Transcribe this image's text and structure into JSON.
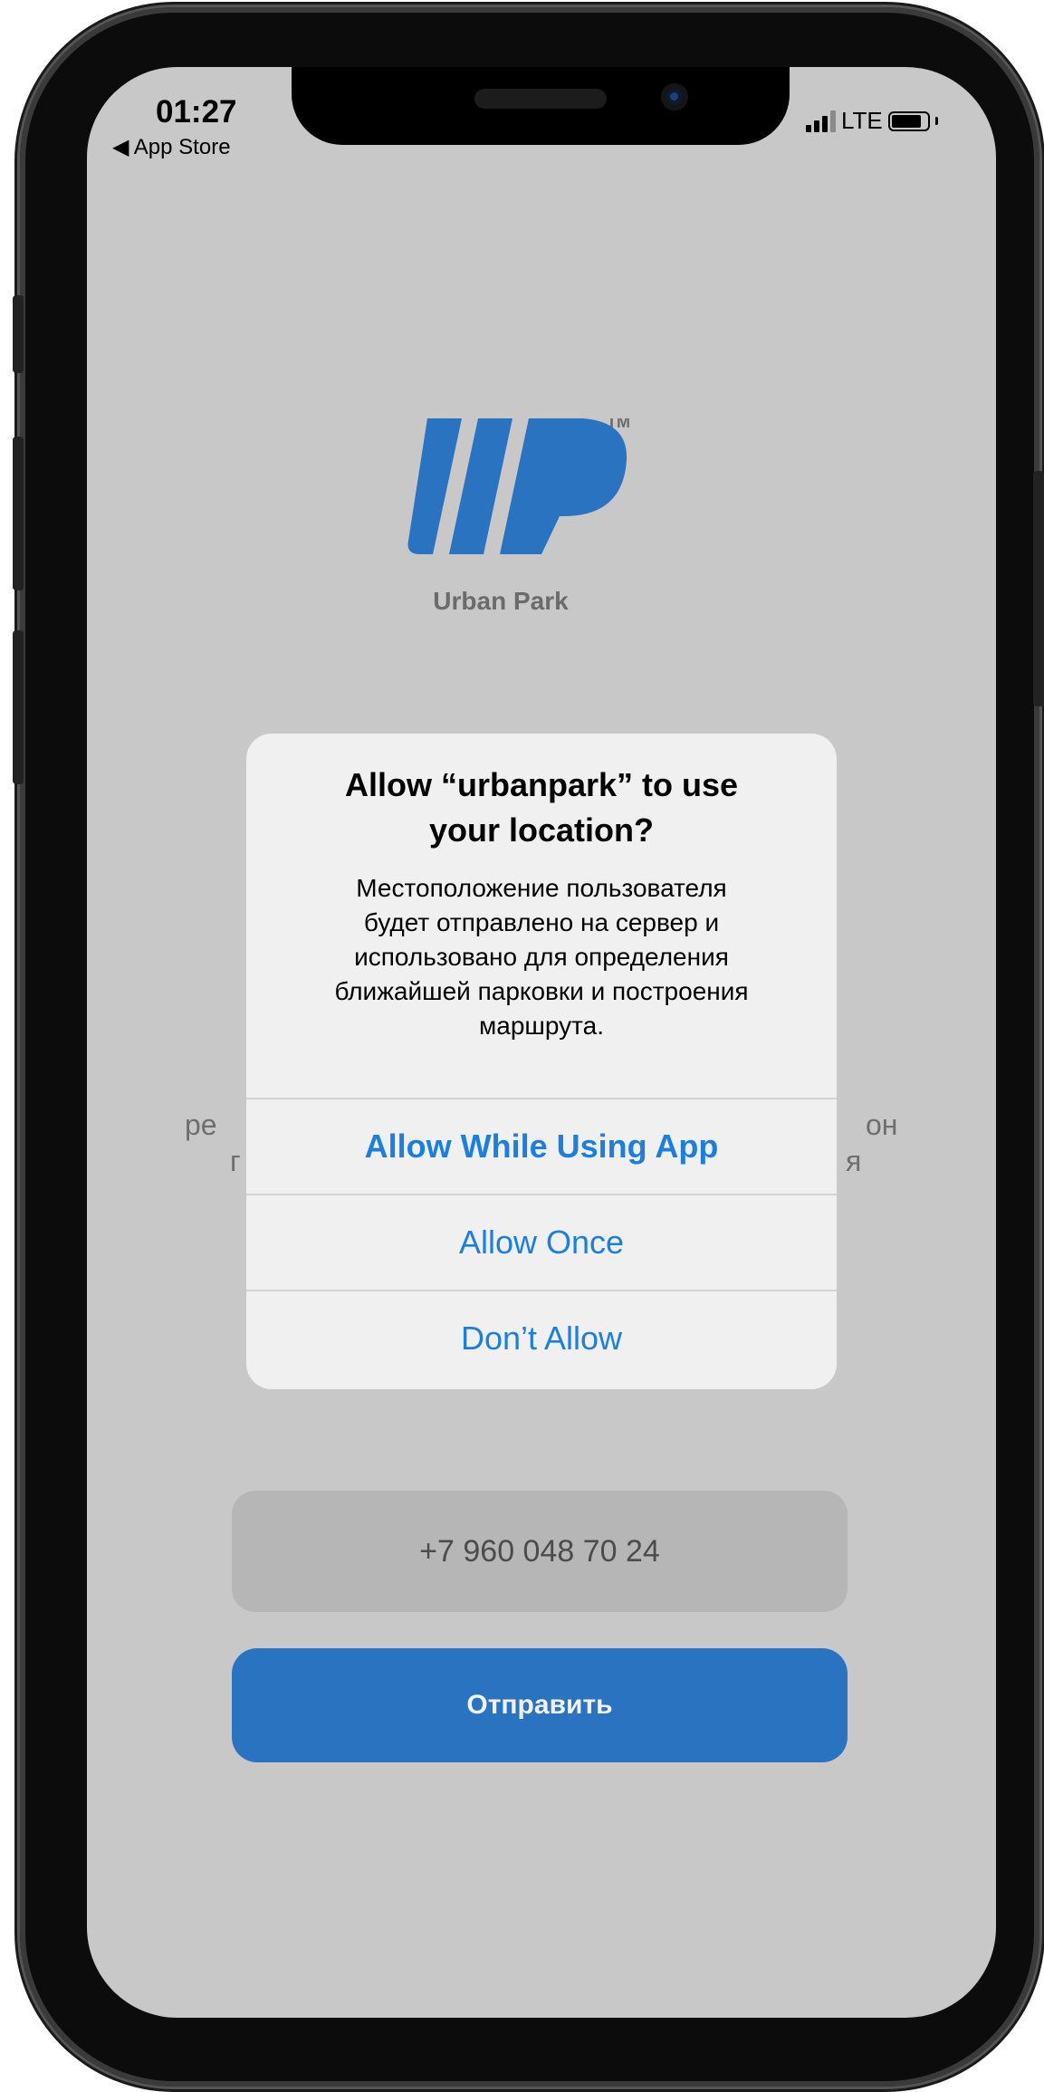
{
  "status_bar": {
    "time": "01:27",
    "back_label": "◀ App Store",
    "network": "LTE"
  },
  "logo": {
    "caption": "Urban Park",
    "trademark": "TM",
    "color": "#2a73c1"
  },
  "background_text": {
    "line1_left": "ре",
    "line1_right": "он",
    "line2_left": "г",
    "line2_right": "я"
  },
  "alert": {
    "title_line1": "Allow “urbanpark” to use",
    "title_line2": "your location?",
    "message_lines": [
      "Местоположение пользователя",
      "будет отправлено на сервер и",
      "использовано для определения",
      "ближайшей парковки и построения",
      "маршрута."
    ],
    "buttons": {
      "allow_while_using": "Allow While Using App",
      "allow_once": "Allow Once",
      "dont_allow": "Don’t Allow"
    },
    "button_color": "#1a7fe1"
  },
  "form": {
    "phone_value": "+7 960 048 70 24",
    "submit_label": "Отправить",
    "submit_color": "#2a73c1"
  }
}
